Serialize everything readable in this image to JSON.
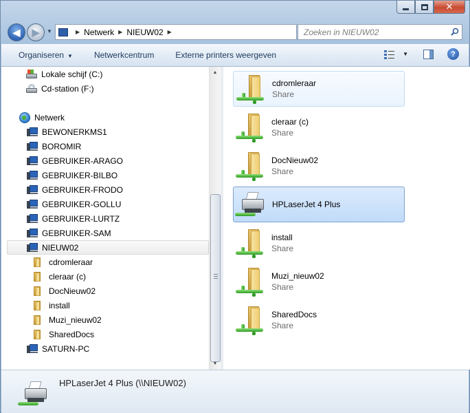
{
  "window": {
    "caption_buttons": [
      "minimize",
      "maximize",
      "close"
    ]
  },
  "address": {
    "crumbs": [
      "Netwerk",
      "NIEUW02"
    ],
    "search_placeholder": "Zoeken in NIEUW02"
  },
  "toolbar": {
    "organize_label": "Organiseren",
    "network_center_label": "Netwerkcentrum",
    "external_printers_label": "Externe printers weergeven"
  },
  "tree": {
    "drives": [
      {
        "label": "Lokale schijf (C:)",
        "icon": "hard-drive-icon"
      },
      {
        "label": "Cd-station (F:)",
        "icon": "cd-drive-icon"
      }
    ],
    "network_label": "Netwerk",
    "computers": [
      "BEWONERKMS1",
      "BOROMIR",
      "GEBRUIKER-ARAGO",
      "GEBRUIKER-BILBO",
      "GEBRUIKER-FRODO",
      "GEBRUIKER-GOLLU",
      "GEBRUIKER-LURTZ",
      "GEBRUIKER-SAM"
    ],
    "selected_computer": "NIEUW02",
    "shares": [
      "cdromleraar",
      "cleraar (c)",
      "DocNieuw02",
      "install",
      "Muzi_nieuw02",
      "SharedDocs"
    ],
    "last_computer": "SATURN-PC"
  },
  "content": {
    "items": [
      {
        "name": "cdromleraar",
        "sub": "Share",
        "kind": "share"
      },
      {
        "name": "cleraar (c)",
        "sub": "Share",
        "kind": "share"
      },
      {
        "name": "DocNieuw02",
        "sub": "Share",
        "kind": "share"
      },
      {
        "name": "HPLaserJet 4 Plus",
        "sub": "",
        "kind": "printer"
      },
      {
        "name": "install",
        "sub": "Share",
        "kind": "share"
      },
      {
        "name": "Muzi_nieuw02",
        "sub": "Share",
        "kind": "share"
      },
      {
        "name": "SharedDocs",
        "sub": "Share",
        "kind": "share"
      }
    ]
  },
  "details": {
    "text": "HPLaserJet 4 Plus (\\\\NIEUW02)"
  }
}
